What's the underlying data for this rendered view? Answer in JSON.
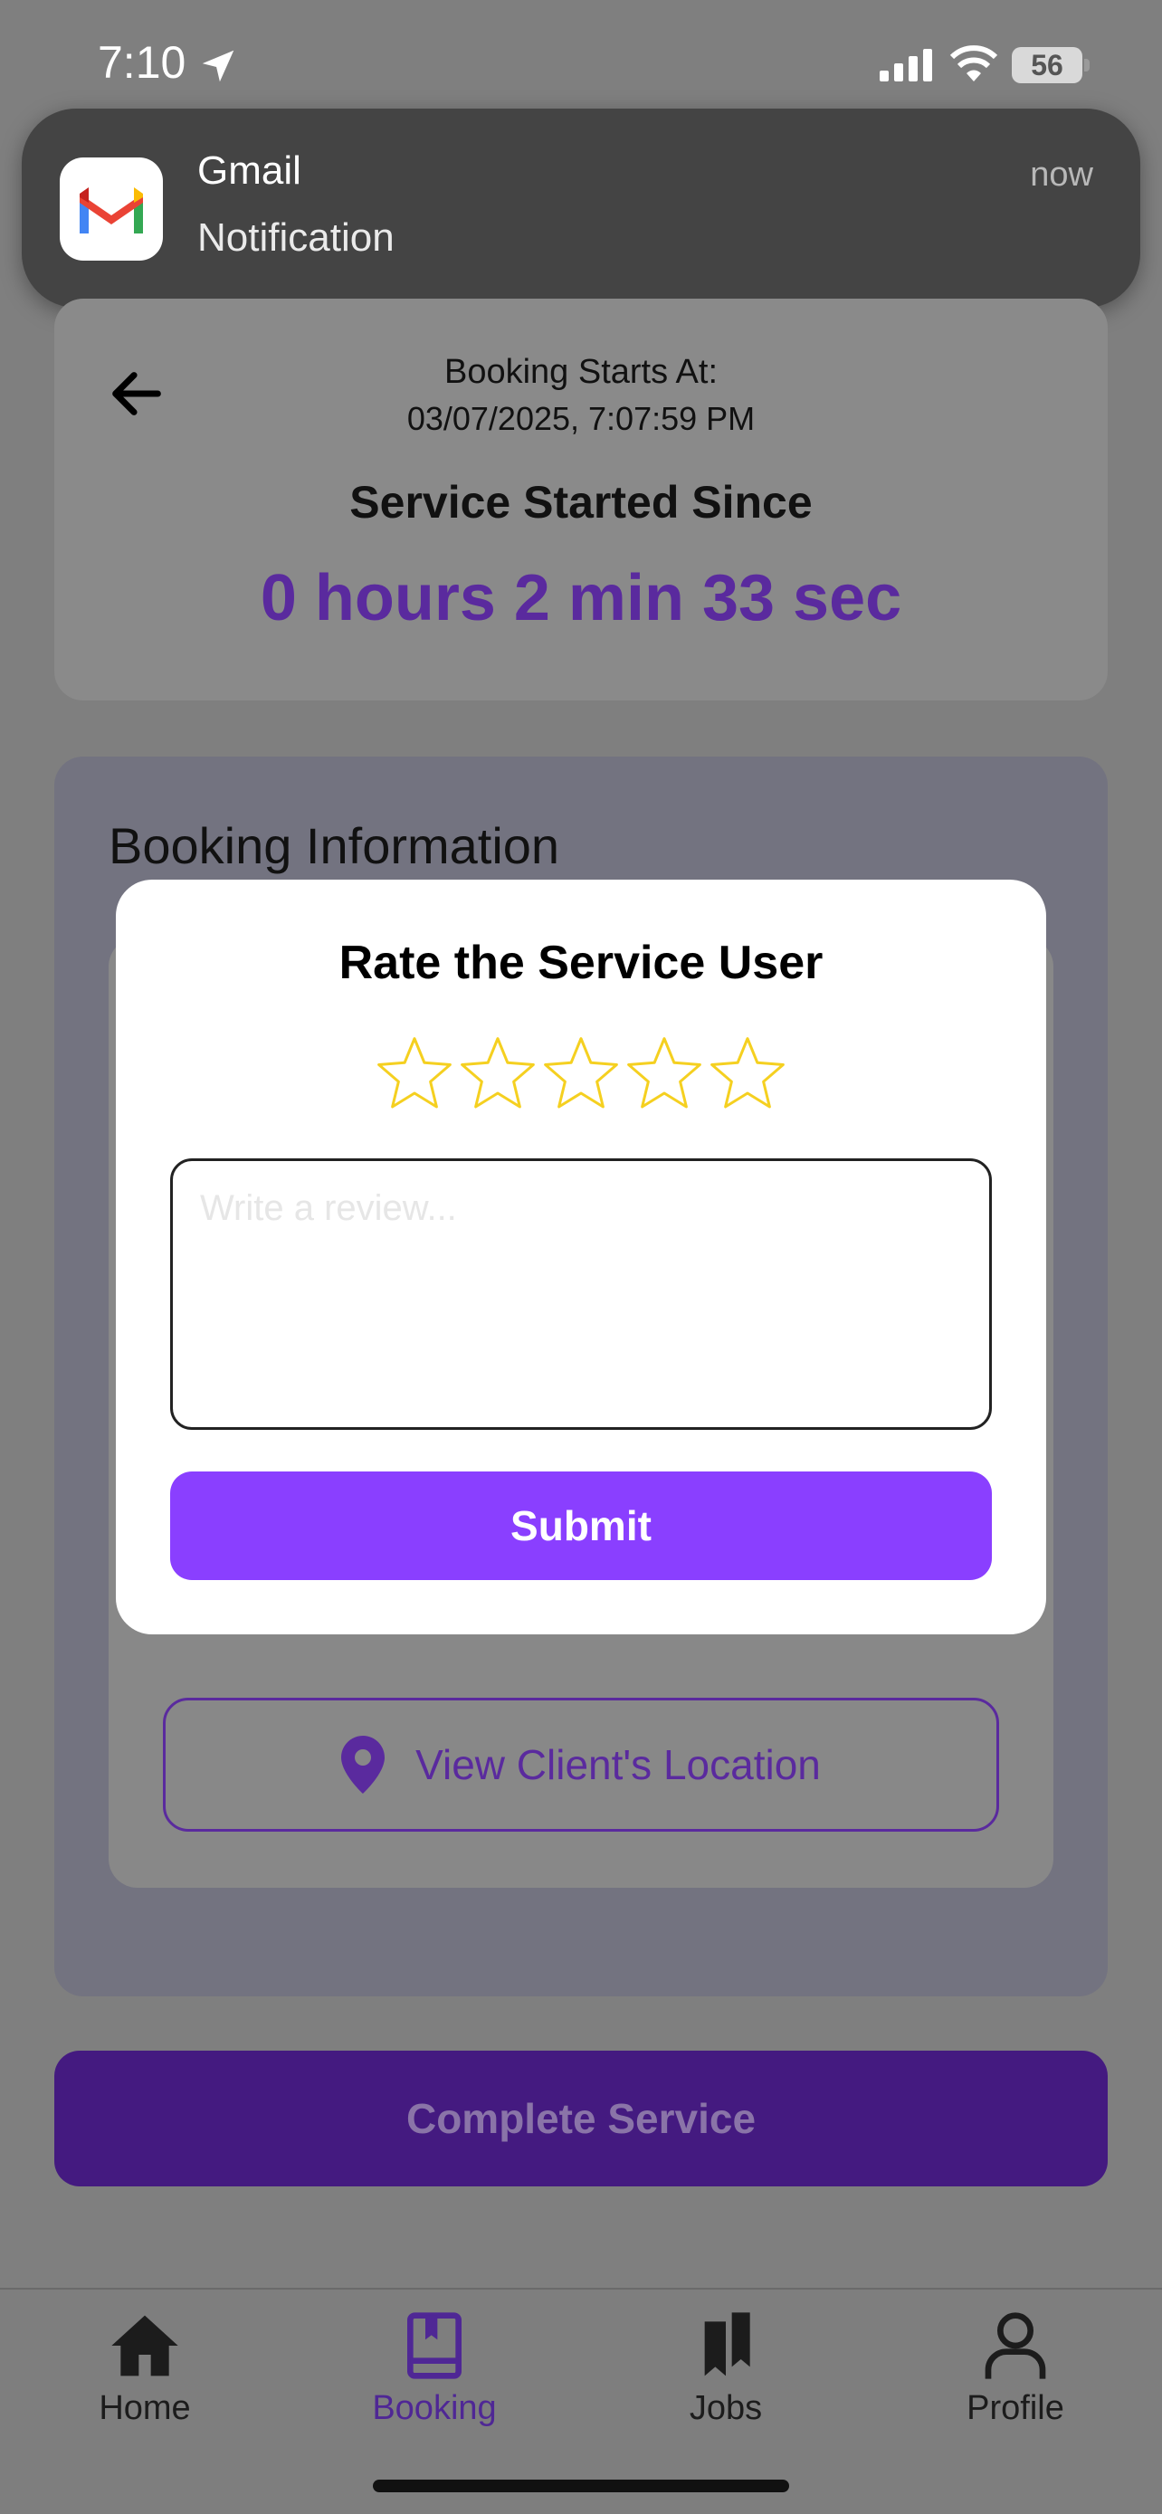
{
  "status_bar": {
    "time": "7:10",
    "battery": "56"
  },
  "notification": {
    "app": "Gmail",
    "body": "Notification",
    "time": "now"
  },
  "booking": {
    "starts_label": "Booking Starts At:",
    "starts_value": "03/07/2025, 7:07:59 PM",
    "since_title": "Service Started Since",
    "timer": "0 hours 2 min 33 sec"
  },
  "info": {
    "title": "Booking Information",
    "location_button": "View Client's Location"
  },
  "complete_button": "Complete Service",
  "modal": {
    "title": "Rate the Service User",
    "rating": 0,
    "rating_max": 5,
    "review_placeholder": "Write a review...",
    "submit": "Submit"
  },
  "tabs": [
    {
      "label": "Home",
      "icon": "home-icon"
    },
    {
      "label": "Booking",
      "icon": "book-icon",
      "active": true
    },
    {
      "label": "Jobs",
      "icon": "bookmarks-icon"
    },
    {
      "label": "Profile",
      "icon": "person-icon"
    }
  ],
  "colors": {
    "accent": "#8a3fff",
    "dark_purple": "#5a2a9e",
    "star": "#f5d020"
  }
}
